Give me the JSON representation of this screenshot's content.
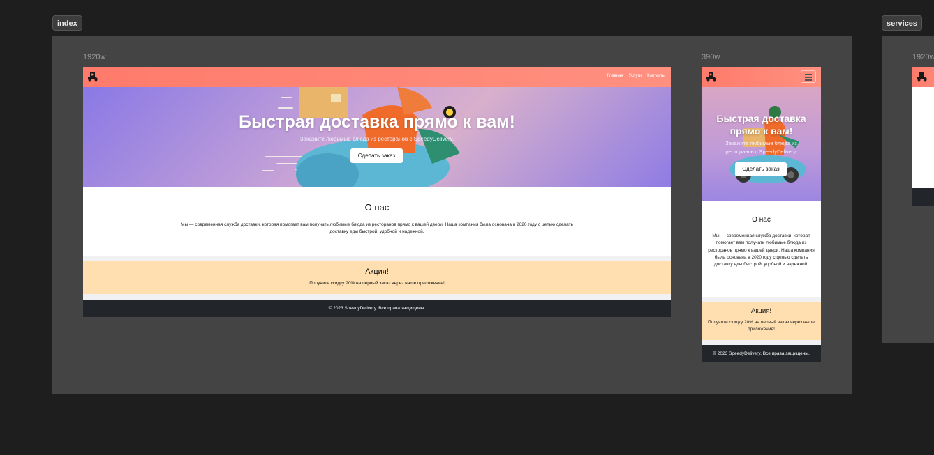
{
  "boards": [
    {
      "tag": "index"
    },
    {
      "tag": "services"
    }
  ],
  "frames": {
    "desktop": {
      "width_label": "1920w",
      "nav_links": [
        "Главная",
        "Услуги",
        "Контакты"
      ],
      "hero_title": "Быстрая доставка прямо к вам!",
      "hero_subtitle": "Закажите любимые блюда из ресторанов с SpeedyDelivery.",
      "hero_button": "Сделать заказ",
      "about_title": "О нас",
      "about_text": "Мы — современная служба доставки, которая помогает вам получать любимые блюда из ресторанов прямо к вашей двери. Наша компания была основана в 2020 году с целью сделать доставку еды быстрой, удобной и надежной.",
      "promo_title": "Акция!",
      "promo_text": "Получите скидку 20% на первый заказ через наше приложение!",
      "footer": "© 2023 SpeedyDelivery. Все права защищены."
    },
    "mobile": {
      "width_label": "390w",
      "hero_title": "Быстрая доставка прямо к вам!",
      "hero_subtitle": "Закажите любимые блюда из ресторанов с SpeedyDelivery.",
      "hero_button": "Сделать заказ",
      "about_title": "О нас",
      "about_text": "Мы — современная служба доставки, которая помогает вам получать любимые блюда из ресторанов прямо к вашей двери. Наша компания была основана в 2020 году с целью сделать доставку еды быстрой, удобной и надежной.",
      "promo_title": "Акция!",
      "promo_text": "Получите скидку 20% на первый заказ через наше приложение!",
      "footer": "© 2023 SpeedyDelivery. Все права защищены."
    },
    "services_desktop": {
      "width_label": "1920w"
    }
  },
  "colors": {
    "canvas": "#1e1e1e",
    "board": "#444444",
    "nav": "#ff8170",
    "promo": "#ffdfb0",
    "footer": "#22252a",
    "hero_purple": "#8a79e6"
  },
  "icons": [
    "scooter-logo-icon",
    "menu-icon"
  ]
}
